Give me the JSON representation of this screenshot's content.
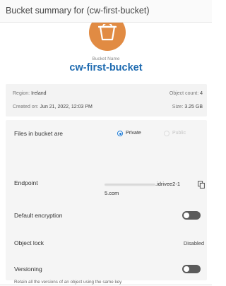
{
  "header": {
    "title": "Bucket summary for (cw-first-bucket)"
  },
  "bucket": {
    "label": "Bucket Name",
    "name": "cw-first-bucket",
    "icon": "bucket-icon",
    "icon_color": "#e18b43",
    "name_color": "#1d6ab0"
  },
  "summary": {
    "region_label": "Region:",
    "region_value": "Ireland",
    "created_label": "Created on:",
    "created_value": "Jun 21, 2022, 12:03 PM",
    "count_label": "Object count:",
    "count_value": "4",
    "size_label": "Size:",
    "size_value": "3.25 GB"
  },
  "details": {
    "files_label": "Files in bucket are",
    "private_label": "Private",
    "public_label": "Public",
    "selected_visibility": "Private",
    "endpoint_label": "Endpoint",
    "endpoint_line1": ".idrivee2-1",
    "endpoint_line2": "5.com",
    "copy_icon": "copy-icon",
    "encryption_label": "Default encryption",
    "encryption_enabled": false,
    "lock_label": "Object lock",
    "lock_value": "Disabled",
    "versioning_label": "Versioning",
    "versioning_enabled": false,
    "versioning_hint": "Retain all the versions of an object using the same key"
  },
  "colors": {
    "accent": "#1d7bd6",
    "toggle_off": "#5b5b5b"
  }
}
